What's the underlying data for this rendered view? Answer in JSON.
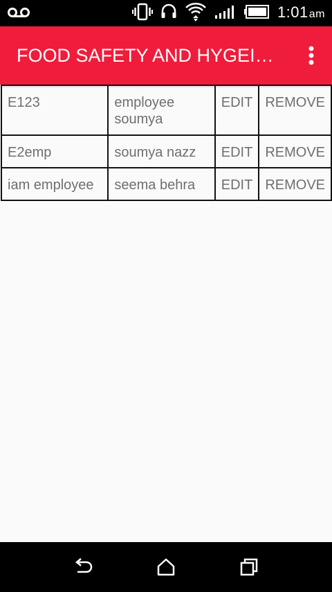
{
  "status_bar": {
    "time": "1:01",
    "ampm": "am",
    "icons": [
      "voicemail-icon",
      "vibrate-icon",
      "headset-icon",
      "wifi-icon",
      "signal-icon",
      "battery-icon"
    ]
  },
  "app_bar": {
    "title": "FOOD SAFETY AND HYGEINE",
    "overflow_icon": "more-vert-icon",
    "background": "#f01c3b"
  },
  "employees": [
    {
      "id": "E123",
      "name": "employee soumya",
      "edit": "EDIT",
      "remove": "REMOVE"
    },
    {
      "id": "E2emp",
      "name": "soumya nazz",
      "edit": "EDIT",
      "remove": "REMOVE"
    },
    {
      "id": "iam employee",
      "name": "seema behra",
      "edit": "EDIT",
      "remove": "REMOVE"
    }
  ],
  "nav_bar": {
    "icons": [
      "back-icon",
      "home-icon",
      "recents-icon"
    ]
  }
}
